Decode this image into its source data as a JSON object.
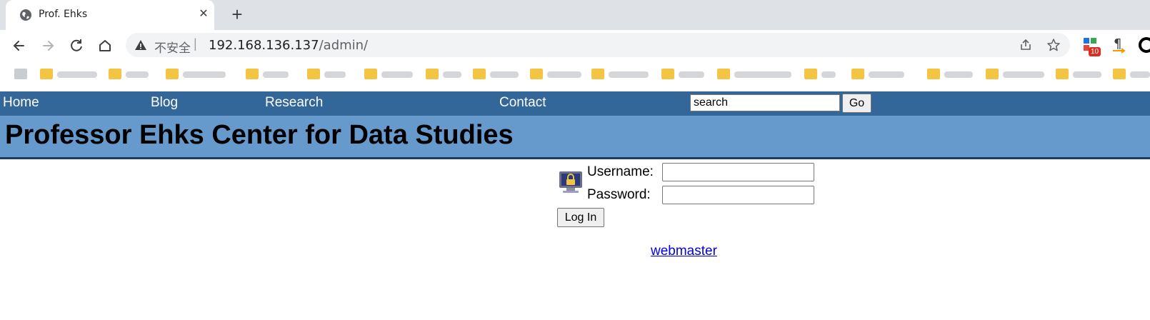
{
  "browser": {
    "tab_title": "Prof. Ehks",
    "omnibox": {
      "security_label": "不安全",
      "host": "192.168.136.137",
      "path": "/admin/"
    },
    "extension_badge": "10",
    "bookmark_count": 20
  },
  "site": {
    "nav": {
      "home": "Home",
      "blog": "Blog",
      "research": "Research",
      "contact": "Contact"
    },
    "search": {
      "value": "search",
      "go_label": "Go"
    },
    "title": "Professor Ehks Center for Data Studies",
    "login": {
      "username_label": "Username:",
      "password_label": "Password:",
      "username_value": "",
      "password_value": "",
      "submit_label": "Log In"
    },
    "footer_link": "webmaster"
  },
  "colors": {
    "nav_bar": "#336699",
    "header_bar": "#6699cc",
    "link": "#0000ee"
  }
}
